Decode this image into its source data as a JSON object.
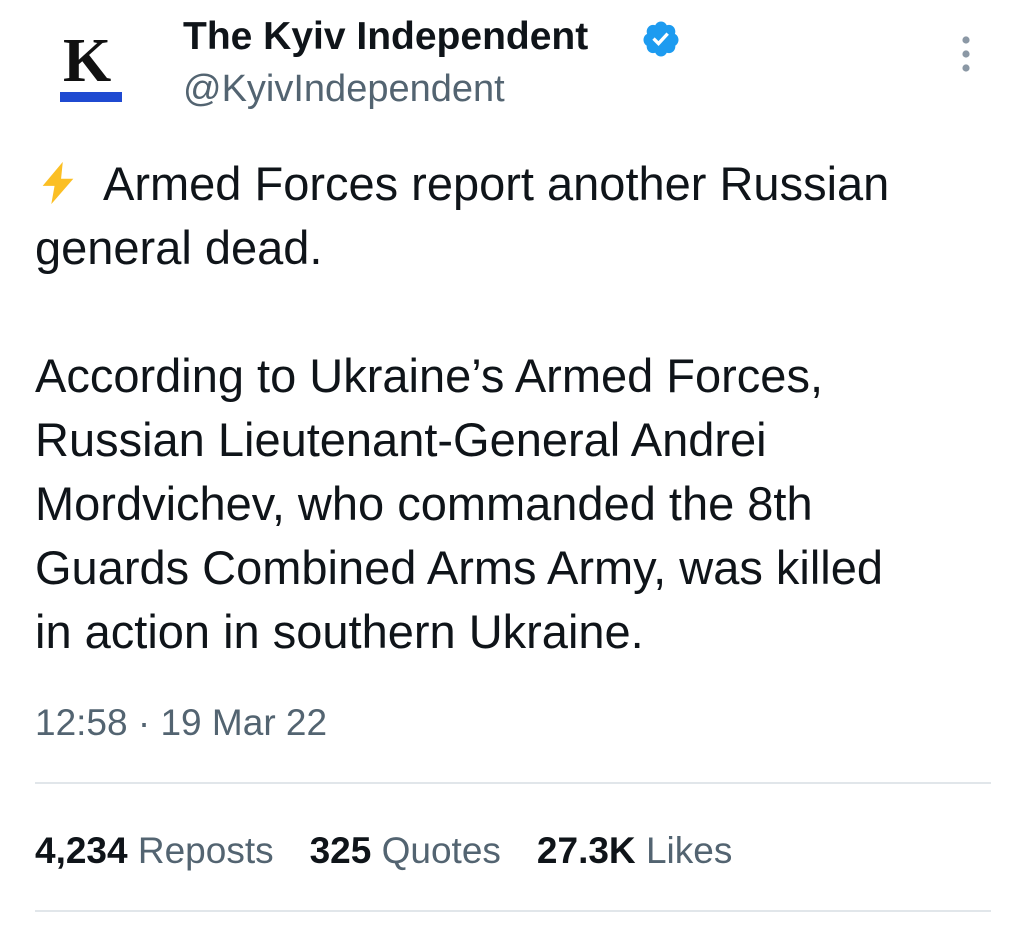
{
  "author": {
    "avatar_letter": "K",
    "display_name": "The Kyiv Independent",
    "handle": "@KyivIndependent",
    "verified": true
  },
  "tweet": {
    "emoji_icon": "high-voltage-icon",
    "line1": "Armed Forces report another Russian\ngeneral dead.",
    "paragraph2": "According to Ukraine’s Armed Forces,\nRussian Lieutenant-General Andrei\nMordvichev, who commanded the 8th\nGuards Combined Arms Army, was killed\nin action in southern Ukraine."
  },
  "meta": {
    "time": "12:58",
    "separator": "·",
    "date": "19 Mar 22"
  },
  "stats": {
    "reposts": {
      "count": "4,234",
      "label": "Reposts"
    },
    "quotes": {
      "count": "325",
      "label": "Quotes"
    },
    "likes": {
      "count": "27.3K",
      "label": "Likes"
    }
  },
  "colors": {
    "text_primary": "#0f1419",
    "text_secondary": "#536471",
    "verified_blue": "#1d9bf0",
    "divider": "#e1e6ea",
    "avatar_bar_blue": "#1f4ad1",
    "bolt_yellow": "#fbbf24"
  }
}
